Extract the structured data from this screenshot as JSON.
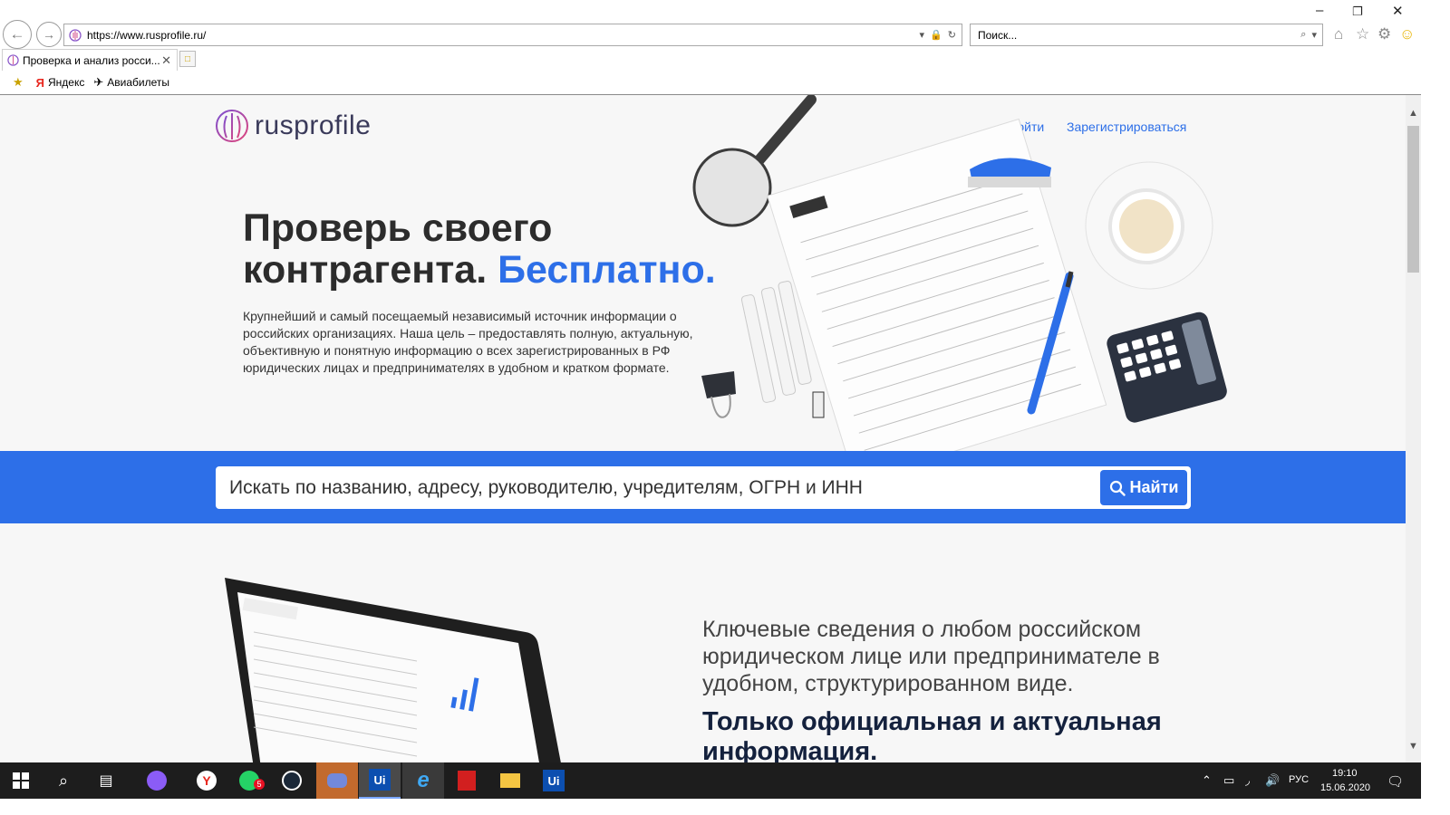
{
  "browser": {
    "url": "https://www.rusprofile.ru/",
    "search_placeholder": "Поиск...",
    "tab_title": "Проверка и анализ росси...",
    "favorites": [
      {
        "label": "Яндекс"
      },
      {
        "label": "Авиабилеты"
      }
    ]
  },
  "page": {
    "logo_text": "rusprofile",
    "login": "Войти",
    "register": "Зарегистрироваться",
    "hero_title_line1": "Проверь своего",
    "hero_title_line2": "контрагента. ",
    "hero_title_accent": "Бесплатно.",
    "hero_description": "Крупнейший и самый посещаемый независимый источник информации о российских организациях. Наша цель – предоставлять полную, актуальную, объективную и понятную информацию о всех зарегистрированных в РФ юридических лицах и предпринимателях в удобном и кратком формате.",
    "search_placeholder": "Искать по названию, адресу, руководителю, учредителям, ОГРН и ИНН",
    "search_button": "Найти",
    "feature_text": "Ключевые сведения о любом российском юридическом лице или предпринимателе в удобном, структурированном виде.",
    "feature_heading": "Только официальная и актуальная информация.",
    "accent_color": "#2d6fe8"
  },
  "taskbar": {
    "language": "РУС",
    "time": "19:10",
    "date": "15.06.2020",
    "whatsapp_badge": "5",
    "uipath_label": "Ui"
  }
}
